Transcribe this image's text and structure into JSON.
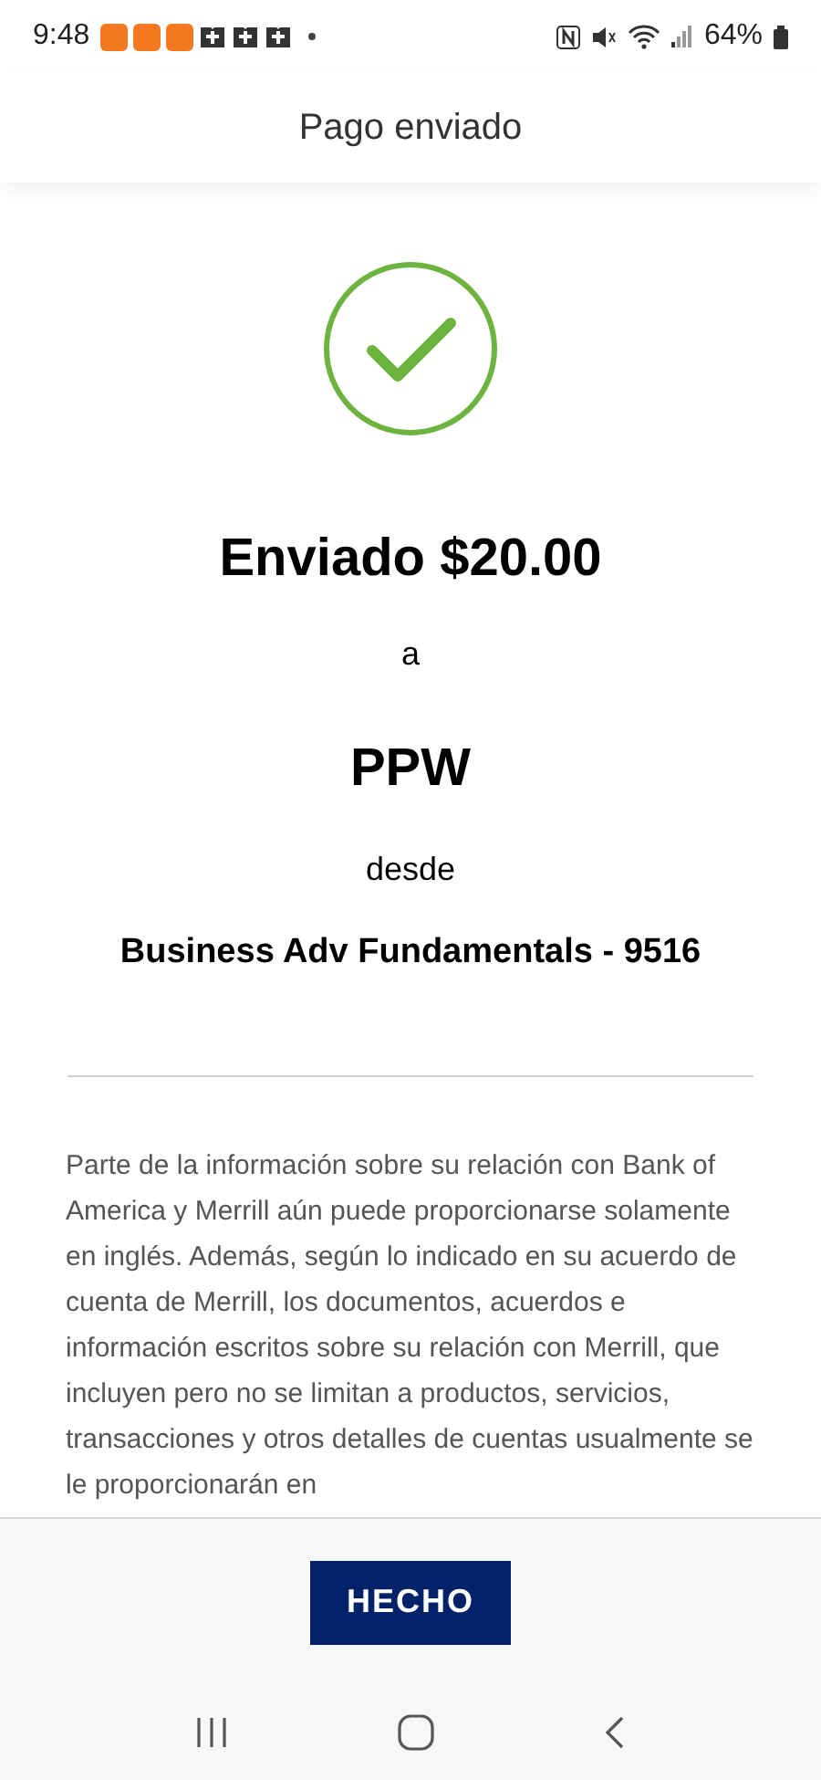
{
  "status_bar": {
    "time": "9:48",
    "battery": "64%"
  },
  "header": {
    "title": "Pago enviado"
  },
  "confirmation": {
    "amount": "Enviado $20.00",
    "to_word": "a",
    "recipient": "PPW",
    "from_word": "desde",
    "account": "Business Adv Fundamentals - 9516"
  },
  "disclaimer": "Parte de la información sobre su relación con Bank of America y Merrill aún puede proporcionarse solamente en inglés. Además, según lo indicado en su acuerdo de cuenta de Merrill, los documentos, acuerdos e información escritos sobre su relación con Merrill, que incluyen pero no se limitan a productos, servicios, transacciones y otros detalles de cuentas usualmente se le proporcionarán en",
  "footer": {
    "button": "HECHO"
  }
}
